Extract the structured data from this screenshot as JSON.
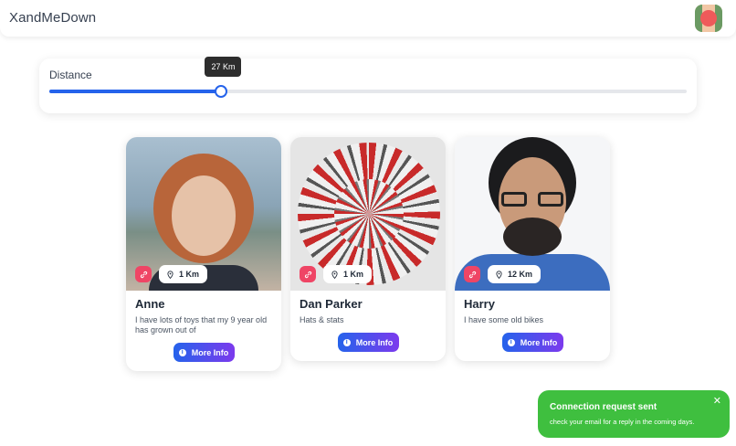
{
  "app": {
    "logo_text": "XandMeDown"
  },
  "header": {
    "avatar_icon": "user-avatar-icon"
  },
  "distance": {
    "label": "Distance",
    "tooltip": "27 Km",
    "value_fraction": 0.27
  },
  "cards": [
    {
      "name": "Anne",
      "description": "I have lots of toys that my 9 year old has grown out of",
      "distance": "1 Km",
      "button": "More Info"
    },
    {
      "name": "Dan Parker",
      "description": "Hats & stats",
      "distance": "1 Km",
      "button": "More Info"
    },
    {
      "name": "Harry",
      "description": "I have some old bikes",
      "distance": "12 Km",
      "button": "More Info"
    }
  ],
  "toast": {
    "title": "Connection request sent",
    "message": "check your email for a reply in the coming days.",
    "close": "✕"
  },
  "colors": {
    "accent": "#2563eb",
    "button_gradient_end": "#7c3aed",
    "link_badge": "#ef4565",
    "toast_bg": "#3fbf3f"
  }
}
